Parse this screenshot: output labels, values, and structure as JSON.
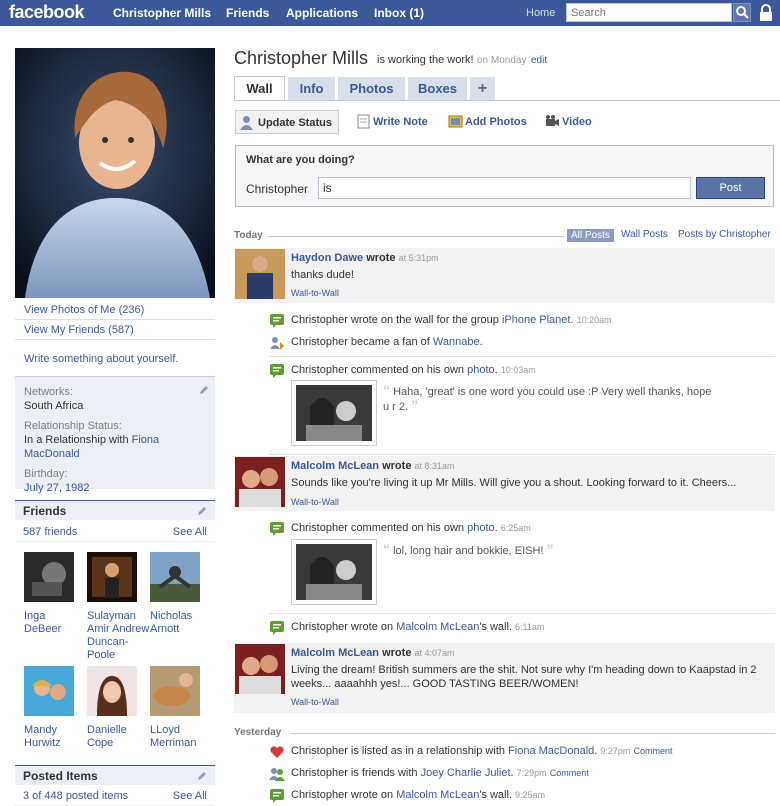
{
  "topbar": {
    "logo": "facebook",
    "nav": [
      "Christopher Mills",
      "Friends",
      "Applications",
      "Inbox (1)"
    ],
    "home": "Home",
    "search_placeholder": "Search"
  },
  "left": {
    "links": [
      "View Photos of Me (236)",
      "View My Friends (587)"
    ],
    "write": "Write something about yourself.",
    "info": {
      "networks_label": "Networks:",
      "networks_value": "South Africa",
      "rel_label": "Relationship Status:",
      "rel_value": "In a Relationship with",
      "rel_partner": "Fiona MacDonald",
      "birthday_label": "Birthday:",
      "birthday_date": "July 27",
      "birthday_year": "1982"
    },
    "friends": {
      "title": "Friends",
      "count": "587 friends",
      "see_all": "See All",
      "items": [
        {
          "name": "Inga DeBeer"
        },
        {
          "name": "Sulayman Amir Andrew Duncan-Poole"
        },
        {
          "name": "Nicholas Arnott"
        },
        {
          "name": "Mandy Hurwitz"
        },
        {
          "name": "Danielle Cope"
        },
        {
          "name": "LLoyd Merriman"
        }
      ]
    },
    "posted": {
      "title": "Posted Items",
      "count": "3 of 448 posted items",
      "see_all": "See All"
    }
  },
  "profile": {
    "name": "Christopher Mills",
    "status": "is working the work!",
    "status_time": "on Monday",
    "edit": "edit"
  },
  "tabs": [
    "Wall",
    "Info",
    "Photos",
    "Boxes",
    "+"
  ],
  "actions": [
    "Update Status",
    "Write Note",
    "Add Photos",
    "Video"
  ],
  "composer": {
    "question": "What are you doing?",
    "who": "Christopher",
    "value": "is",
    "post": "Post"
  },
  "feed": {
    "today": "Today",
    "yesterday": "Yesterday",
    "filters": [
      "All Posts",
      "Wall Posts",
      "Posts by Christopher"
    ],
    "w2w": "Wall-to-Wall",
    "wrote": "wrote",
    "post1": {
      "author": "Haydon Dawe",
      "time": "at 5:31pm",
      "text": "thanks dude!"
    },
    "story1": {
      "pre": "Christopher wrote on the wall for the group",
      "link": "iPhone Planet",
      "post": ".",
      "time": "10:20am"
    },
    "story2": {
      "pre": "Christopher became a fan of",
      "link": "Wannabe",
      "post": "."
    },
    "story3": {
      "pre": "Christopher commented on his own",
      "link": "photo",
      "post": ".",
      "time": "10:03am"
    },
    "comment1": "Haha, 'great' is one word you could use :P Very well thanks, hope u r 2.",
    "post2": {
      "author": "Malcolm McLean",
      "time": "at 8:31am",
      "text": "Sounds like you're living it up Mr Mills. Will give you a shout. Looking forward to it. Cheers..."
    },
    "story4": {
      "pre": "Christopher commented on his own",
      "link": "photo",
      "post": ".",
      "time": "6:25am"
    },
    "comment2": "lol, long hair and bokkie, EISH!",
    "story5": {
      "pre": "Christopher wrote on",
      "link": "Malcolm McLean",
      "post": "'s wall.",
      "time": "6:11am"
    },
    "post3": {
      "author": "Malcolm McLean",
      "time": "at 4:07am",
      "text": "Living the dream! British summers are the shit. Not sure why I'm heading down to Kaapstad in 2 weeks... aaaahhh yes!... GOOD TASTING BEER/WOMEN!"
    },
    "story6": {
      "pre": "Christopher is listed as in a relationship with",
      "link": "Fiona MacDonald",
      "post": ".",
      "time": "9:27pm",
      "comment": "Comment"
    },
    "story7": {
      "pre": "Christopher is friends with",
      "link": "Joey Charlie Juliet",
      "post": ".",
      "time": "7:29pm",
      "comment": "Comment"
    },
    "story8": {
      "pre": "Christopher wrote on",
      "link": "Malcolm McLean",
      "post": "'s wall.",
      "time": "9:25am"
    }
  }
}
